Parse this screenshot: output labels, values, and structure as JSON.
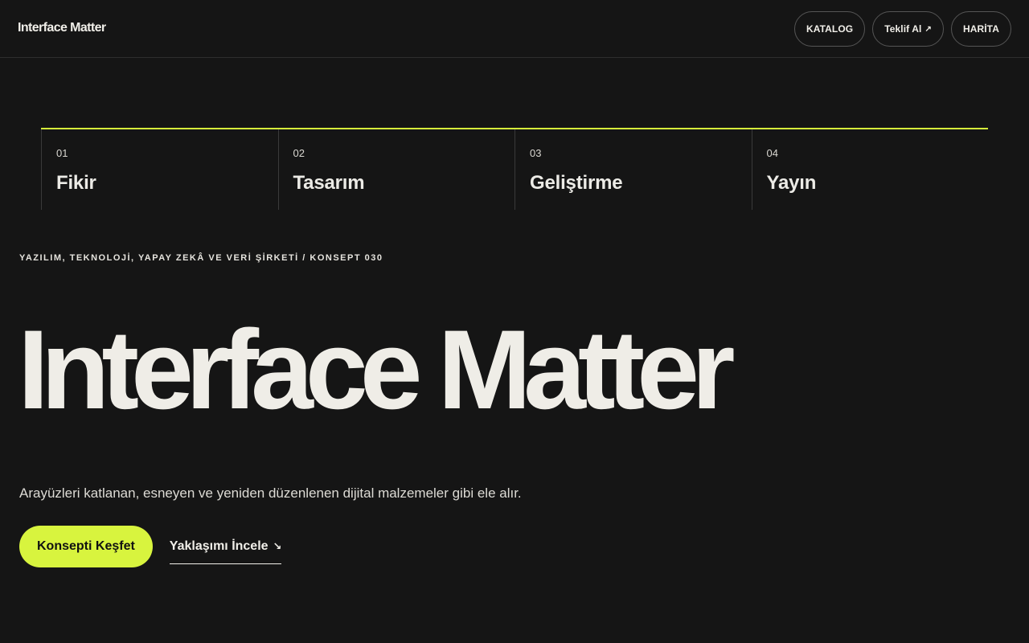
{
  "header": {
    "brand": "Interface Matter",
    "nav": [
      {
        "label": "KATALOG",
        "arrow": ""
      },
      {
        "label": "Teklif Al",
        "arrow": "↗"
      },
      {
        "label": "HARİTA",
        "arrow": ""
      }
    ]
  },
  "steps": [
    {
      "num": "01",
      "title": "Fikir"
    },
    {
      "num": "02",
      "title": "Tasarım"
    },
    {
      "num": "03",
      "title": "Geliştirme"
    },
    {
      "num": "04",
      "title": "Yayın"
    }
  ],
  "hero": {
    "eyebrow": "YAZILIM, TEKNOLOJİ, YAPAY ZEKÂ VE VERİ ŞİRKETİ / KONSEPT 030",
    "title": "Interface Matter",
    "lede": "Arayüzleri katlanan, esneyen ve yeniden düzenlenen dijital malzemeler gibi ele alır.",
    "primary_cta": "Konsepti Keşfet",
    "secondary_cta": "Yaklaşımı İncele",
    "secondary_arrow": "↘"
  },
  "colors": {
    "background": "#151515",
    "accent": "#d8f43e",
    "text": "#f1efe9"
  }
}
